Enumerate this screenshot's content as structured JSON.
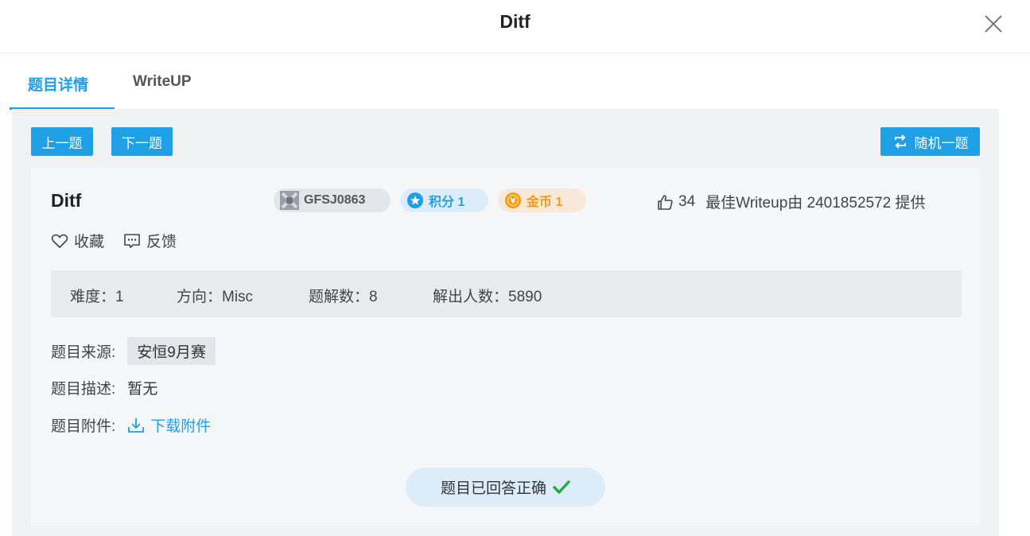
{
  "dialog": {
    "title": "Ditf"
  },
  "tabs": [
    {
      "label": "题目详情",
      "active": true
    },
    {
      "label": "WriteUP",
      "active": false
    }
  ],
  "nav": {
    "prev_label": "上一题",
    "next_label": "下一题",
    "random_label": "随机一题"
  },
  "challenge": {
    "title": "Ditf",
    "author": "GFSJ0863",
    "score_label": "积分 1",
    "coin_label": "金币 1",
    "likes": "34",
    "best_writeup": "最佳Writeup由 2401852572 提供",
    "favorite_label": "收藏",
    "feedback_label": "反馈",
    "stats": {
      "difficulty": "难度：1",
      "direction": "方向：Misc",
      "writeups": "题解数：8",
      "solvers": "解出人数：5890"
    },
    "source_label": "题目来源:",
    "source_value": "安恒9月赛",
    "description_label": "题目描述:",
    "description_value": "暂无",
    "attachment_label": "题目附件:",
    "download_label": "下载附件",
    "solved_status": "题目已回答正确"
  },
  "colors": {
    "accent": "#1e9fe6",
    "coin": "#f29a16",
    "success": "#2aa845"
  }
}
